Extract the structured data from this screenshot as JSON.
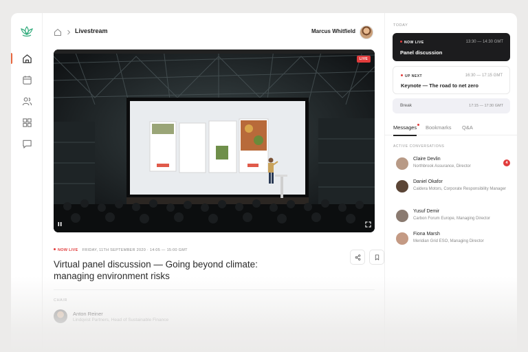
{
  "breadcrumb": {
    "current": "Livestream"
  },
  "user": {
    "name": "Marcus Whitfield"
  },
  "video": {
    "live_label": "LIVE"
  },
  "event": {
    "status": "NOW LIVE",
    "datetime": "FRIDAY, 11TH SEPTEMBER 2020 · 14:05 — 15:00 GMT",
    "title": "Virtual panel discussion — Going beyond climate: managing environment risks"
  },
  "chair": {
    "label": "CHAIR",
    "name": "Anton Reiner",
    "role": "Lindqvist Partners, Head of Sustainable Finance"
  },
  "schedule": {
    "heading": "TODAY",
    "sessions": [
      {
        "tag": "NOW LIVE",
        "time": "13:30 — 14:30 GMT",
        "title": "Panel discussion"
      },
      {
        "tag": "UP NEXT",
        "time": "16:30 — 17:15 GMT",
        "title": "Keynote — The road to net zero"
      },
      {
        "tag": "",
        "time": "17:15 — 17:30 GMT",
        "title": "Break"
      }
    ]
  },
  "tabs": [
    {
      "label": "Messages"
    },
    {
      "label": "Bookmarks"
    },
    {
      "label": "Q&A"
    }
  ],
  "conversations": {
    "heading": "ACTIVE CONVERSATIONS",
    "items": [
      {
        "name": "Claire Devlin",
        "org": "Northbrook Assurance, Director",
        "badge": "4",
        "avatar_color": "#b89a86"
      },
      {
        "name": "Daniel Okafor",
        "org": "Caldera Motors, Corporate Responsibility Manager",
        "badge": "",
        "avatar_color": "#5b4536"
      },
      {
        "name": "Yusuf Demir",
        "org": "Carbon Forum Europe, Managing Director",
        "badge": "",
        "avatar_color": "#8a7a70"
      },
      {
        "name": "Fiona Marsh",
        "org": "Meridian Grid ESO, Managing Director",
        "badge": "",
        "avatar_color": "#c49a84"
      }
    ]
  },
  "colors": {
    "accent": "#e13c3c",
    "nav_active": "#e8663d",
    "logo": "#2faa7a"
  }
}
